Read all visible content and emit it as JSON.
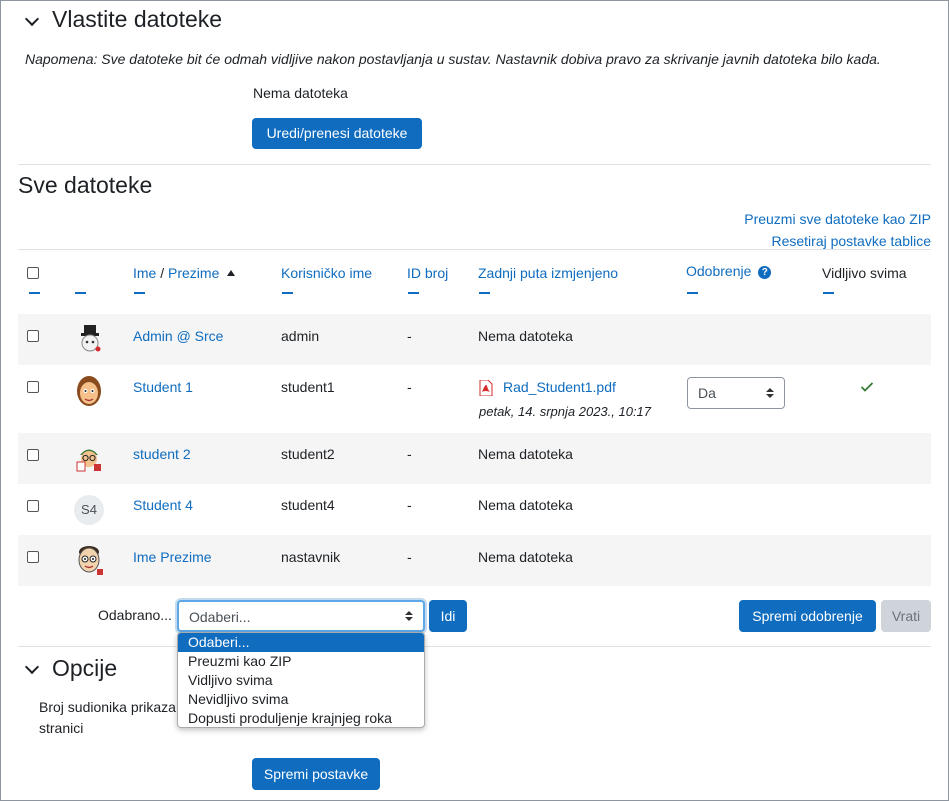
{
  "own_files": {
    "title": "Vlastite datoteke",
    "note": "Napomena: Sve datoteke bit će odmah vidljive nakon postavljanja u sustav. Nastavnik dobiva pravo za skrivanje javnih datoteka bilo kada.",
    "no_files": "Nema datoteka",
    "upload_button": "Uredi/prenesi datoteke"
  },
  "all_files": {
    "title": "Sve datoteke",
    "download_zip": "Preuzmi sve datoteke kao ZIP",
    "reset_table": "Resetiraj postavke tablice"
  },
  "table": {
    "headers": {
      "first_name": "Ime",
      "separator": " / ",
      "last_name": "Prezime",
      "username": "Korisničko ime",
      "id_number": "ID broj",
      "last_modified": "Zadnji puta izmjenjeno",
      "approval": "Odobrenje",
      "visible": "Vidljivo svima"
    },
    "rows": [
      {
        "name": "Admin @ Srce",
        "username": "admin",
        "id": "-",
        "file": "Nema datoteka",
        "avatar": "hat-avatar"
      },
      {
        "name": "Student 1",
        "username": "student1",
        "id": "-",
        "file_link": "Rad_Student1.pdf",
        "file_date": "petak, 14. srpnja 2023., 10:17",
        "approval": "Da",
        "avatar": "student-avatar"
      },
      {
        "name": "student 2",
        "username": "student2",
        "id": "-",
        "file": "Nema datoteka",
        "avatar": "glasses-avatar"
      },
      {
        "name": "Student 4",
        "username": "student4",
        "id": "-",
        "file": "Nema datoteka",
        "initials": "S4"
      },
      {
        "name": "Ime Prezime",
        "username": "nastavnik",
        "id": "-",
        "file": "Nema datoteka",
        "avatar": "teacher-avatar"
      }
    ]
  },
  "bulk": {
    "label": "Odabrano...",
    "select_value": "Odaberi...",
    "go_button": "Idi",
    "save_approval": "Spremi odobrenje",
    "revert": "Vrati",
    "options": [
      "Odaberi...",
      "Preuzmi kao ZIP",
      "Vidljivo svima",
      "Nevidljivo svima",
      "Dopusti produljenje krajnjeg roka"
    ]
  },
  "options_section": {
    "title": "Opcije",
    "per_page_label_1": "Broj sudionika prikaza",
    "per_page_label_2": "stranici",
    "save_settings": "Spremi postavke"
  },
  "colors": {
    "accent": "#0f6cbf",
    "success": "#357a32",
    "pdf": "#d62b2b"
  }
}
